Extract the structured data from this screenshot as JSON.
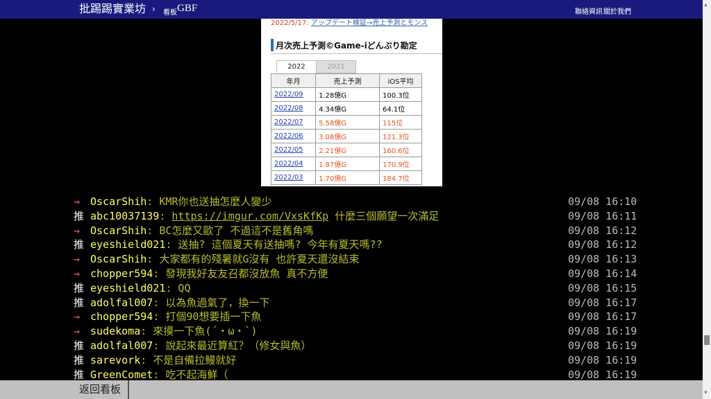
{
  "header": {
    "site_title": "批踢踢實業坊",
    "separator": "›",
    "board_label": "看板",
    "board_name": "GBF",
    "nav": {
      "contact": "聯絡資訊",
      "about": "關於我們"
    }
  },
  "image": {
    "top_link_prefix": "2022/5/17: ",
    "top_link_text": "アップデート検証→売上予測とモンス",
    "heading": "月次売上予測©Game-iどんぶり勘定",
    "tabs": [
      "2022",
      "2021"
    ],
    "columns": [
      "年月",
      "売上予測",
      "iOS平均"
    ],
    "rows": [
      {
        "month": "2022/09",
        "sales": "1.28億G",
        "ios": "100.3位",
        "highlight": false
      },
      {
        "month": "2022/08",
        "sales": "4.34億G",
        "ios": "64.1位",
        "highlight": false
      },
      {
        "month": "2022/07",
        "sales": "5.58億G",
        "ios": "115位",
        "highlight": true
      },
      {
        "month": "2022/06",
        "sales": "3.08億G",
        "ios": "121.3位",
        "highlight": true
      },
      {
        "month": "2022/05",
        "sales": "2.21億G",
        "ios": "160.6位",
        "highlight": true
      },
      {
        "month": "2022/04",
        "sales": "1.87億G",
        "ios": "170.9位",
        "highlight": true
      },
      {
        "month": "2022/03",
        "sales": "1.70億G",
        "ios": "184.7位",
        "highlight": true
      }
    ]
  },
  "comments": [
    {
      "tag": "→",
      "user": "OscarShih",
      "content": ": KMR你也送抽怎麼人變少",
      "time": "09/08 16:10"
    },
    {
      "tag": "推",
      "user": "abc10037139",
      "content": ": ",
      "link": "https://imgur.com/VxsKfKp",
      "content_after": " 什麼三個願望一次滿足",
      "time": "09/08 16:11"
    },
    {
      "tag": "→",
      "user": "OscarShih",
      "content": ": BC怎麼又歐了 不過這不是舊角嗎",
      "time": "09/08 16:12"
    },
    {
      "tag": "推",
      "user": "eyeshield021",
      "content": ": 送抽? 這個夏天有送抽嗎? 今年有夏天嗎??",
      "time": "09/08 16:12"
    },
    {
      "tag": "→",
      "user": "OscarShih",
      "content": ": 大家都有的殘暑就G沒有 也許夏天還沒結束",
      "time": "09/08 16:13"
    },
    {
      "tag": "→",
      "user": "chopper594",
      "content": ": 發現我好友友召都沒放魚  真不方便",
      "time": "09/08 16:14"
    },
    {
      "tag": "推",
      "user": "eyeshield021",
      "content": ": QQ",
      "time": "09/08 16:15"
    },
    {
      "tag": "推",
      "user": "adolfal007",
      "content": ": 以為魚過氣了，換一下",
      "time": "09/08 16:17"
    },
    {
      "tag": "→",
      "user": "chopper594",
      "content": ": 打個90想要插一下魚",
      "time": "09/08 16:17"
    },
    {
      "tag": "→",
      "user": "sudekoma",
      "content": ": 來摸一下魚(´・ω・`)",
      "time": "09/08 16:19"
    },
    {
      "tag": "推",
      "user": "adolfal007",
      "content": ": 說起來最近算紅？（修女與魚）",
      "time": "09/08 16:19"
    },
    {
      "tag": "推",
      "user": "sarevork",
      "content": ": 不是自備拉鰻就好",
      "time": "09/08 16:19"
    },
    {
      "tag": "推",
      "user": "GreenComet",
      "content": ": 吃不起海鮮（",
      "time": "09/08 16:19"
    }
  ],
  "footer": {
    "back_label": "返回看板"
  },
  "colors": {
    "header_bg": "#1a1a7e",
    "push_user": "#ffff66",
    "push_content": "#bbbb33",
    "arrow_tag": "#ff5555"
  }
}
